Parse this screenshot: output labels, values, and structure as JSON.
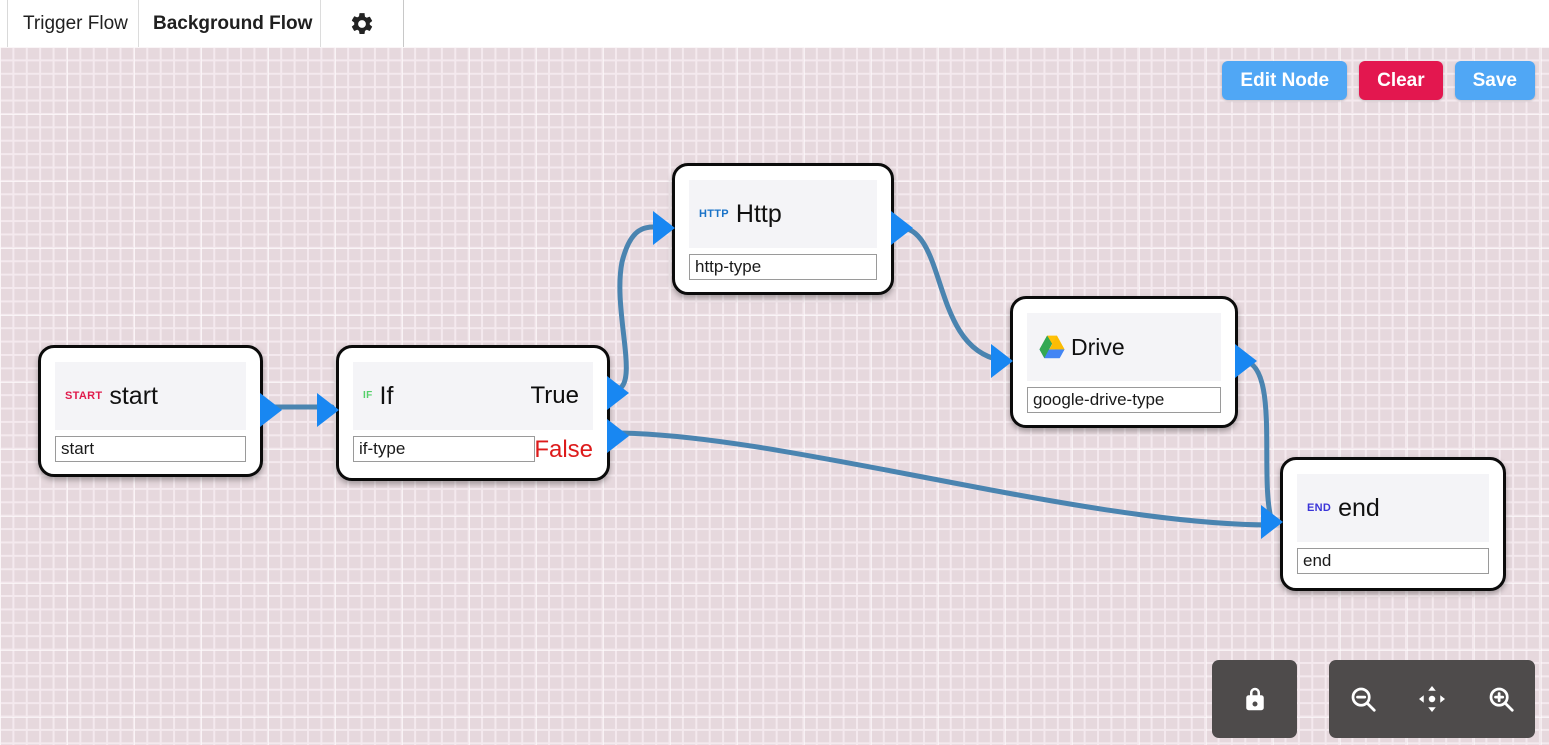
{
  "header": {
    "tabs": [
      {
        "label": "Trigger Flow",
        "active": false
      },
      {
        "label": "Background Flow",
        "active": true
      }
    ],
    "settings_icon": "gear-icon"
  },
  "actions": {
    "edit_node_label": "Edit Node",
    "clear_label": "Clear",
    "save_label": "Save",
    "blue_color": "#50a7f5",
    "red_color": "#e3174f"
  },
  "canvas": {
    "background_color": "#e6d8dd",
    "grid_line_color": "#f4e9ee",
    "edge_color": "#4a84b0",
    "handle_color": "#1887f2"
  },
  "nodes": [
    {
      "id": "start",
      "badge": "START",
      "badge_color": "#e01b4c",
      "title": "start",
      "field_value": "start",
      "icon": "start-badge-icon"
    },
    {
      "id": "if",
      "badge": "IF",
      "badge_color": "#55d06a",
      "title": "If",
      "field_value": "if-type",
      "icon": "if-badge-icon",
      "branches": [
        {
          "label": "True",
          "color": "#0d0d0d"
        },
        {
          "label": "False",
          "color": "#dd1b1b"
        }
      ]
    },
    {
      "id": "http",
      "badge": "HTTP",
      "badge_color": "#1a73c8",
      "title": "Http",
      "field_value": "http-type",
      "icon": "http-badge-icon"
    },
    {
      "id": "drive",
      "badge": "",
      "title": "Drive",
      "field_value": "google-drive-type",
      "icon": "google-drive-icon"
    },
    {
      "id": "end",
      "badge": "END",
      "badge_color": "#3a34d8",
      "title": "end",
      "field_value": "end",
      "icon": "end-badge-icon"
    }
  ],
  "controls": {
    "lock": "lock-icon",
    "zoom_out": "zoom-out-icon",
    "fit_view": "fit-view-icon",
    "zoom_in": "zoom-in-icon",
    "panel_color": "#4e4b4b"
  }
}
